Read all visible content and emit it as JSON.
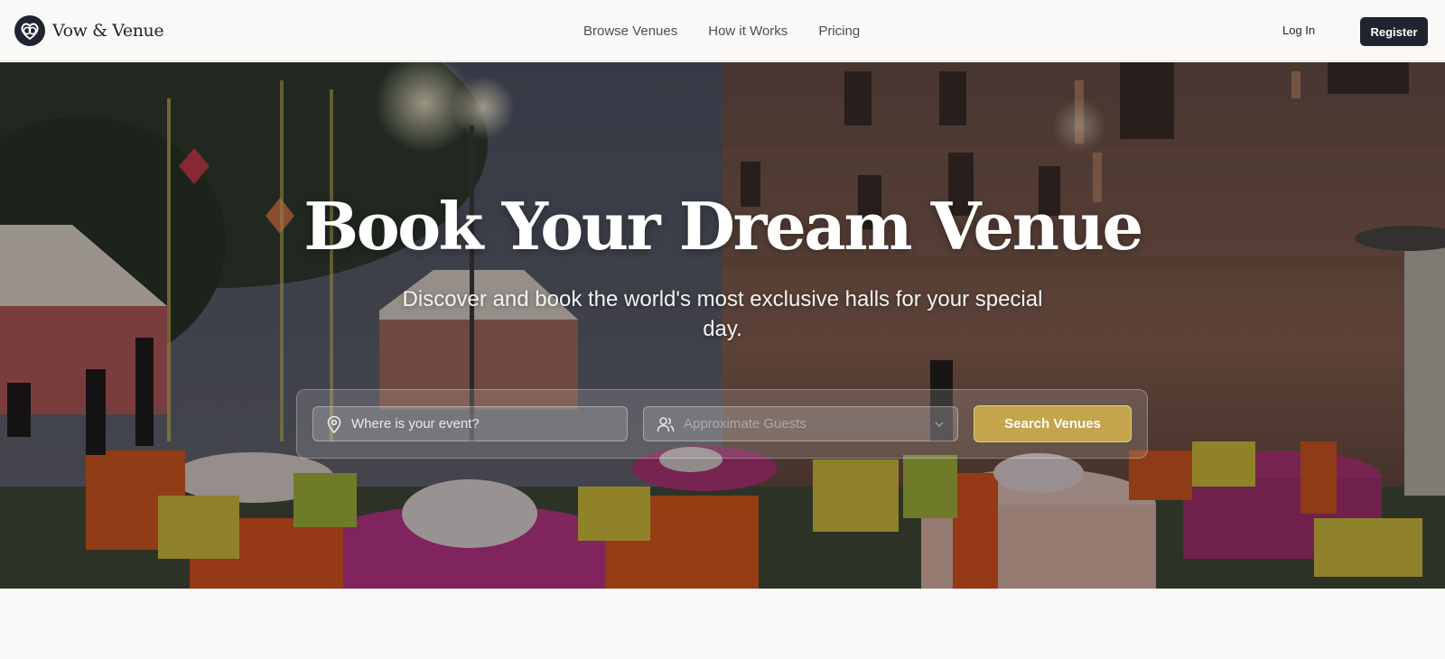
{
  "brand": {
    "name": "Vow & Venue",
    "logo_icon": "heart-rings-logo-icon"
  },
  "nav": {
    "links": [
      "Browse Venues",
      "How it Works",
      "Pricing"
    ],
    "login_label": "Log In",
    "register_label": "Register"
  },
  "hero": {
    "title": "Book Your Dream Venue",
    "subtitle": "Discover and book the world's most exclusive halls for your special day.",
    "background": "photo of an evening outdoor wedding venue with decorated tables and a palace facade"
  },
  "search": {
    "location_placeholder": "Where is your event?",
    "location_icon": "map-pin-icon",
    "guests_placeholder": "Approximate Guests",
    "guests_icon": "users-icon",
    "button_label": "Search Venues"
  },
  "colors": {
    "primary_dark": "#1f2430",
    "accent_gold": "#c4a44c",
    "page_bg": "#faf9f7"
  }
}
